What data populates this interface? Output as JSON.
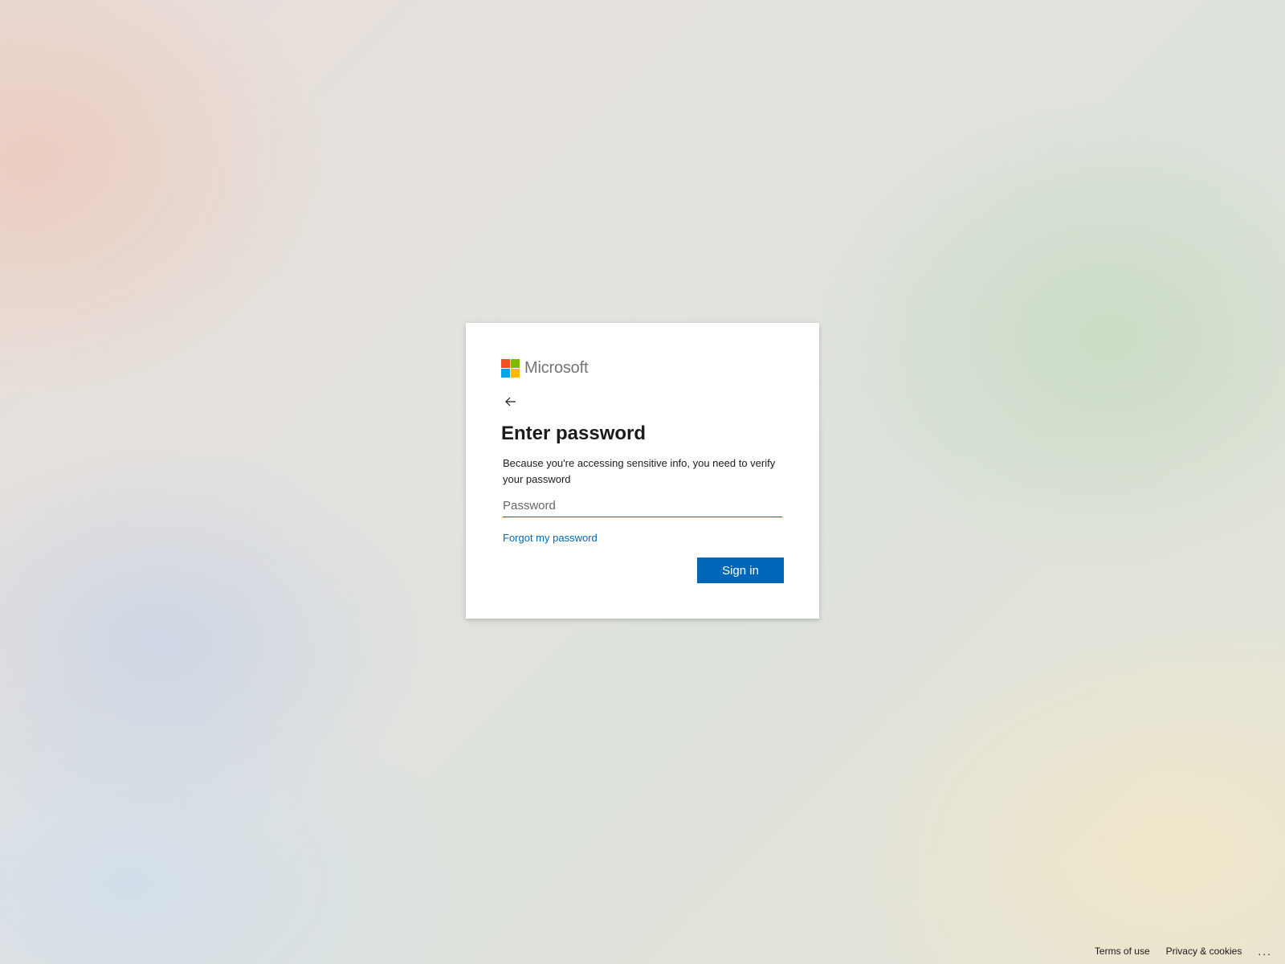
{
  "brand": {
    "name": "Microsoft",
    "logo_colors": [
      "#f25022",
      "#7fba00",
      "#00a4ef",
      "#ffb900"
    ]
  },
  "card": {
    "back_icon": "arrow-left-icon",
    "title": "Enter password",
    "description": "Because you're accessing sensitive info, you need to verify your password",
    "password_placeholder": "Password",
    "password_value": "",
    "forgot_link": "Forgot my password",
    "signin_label": "Sign in"
  },
  "footer": {
    "terms": "Terms of use",
    "privacy": "Privacy & cookies",
    "more": "..."
  },
  "colors": {
    "accent": "#0067b8",
    "text": "#1b1b1b"
  }
}
